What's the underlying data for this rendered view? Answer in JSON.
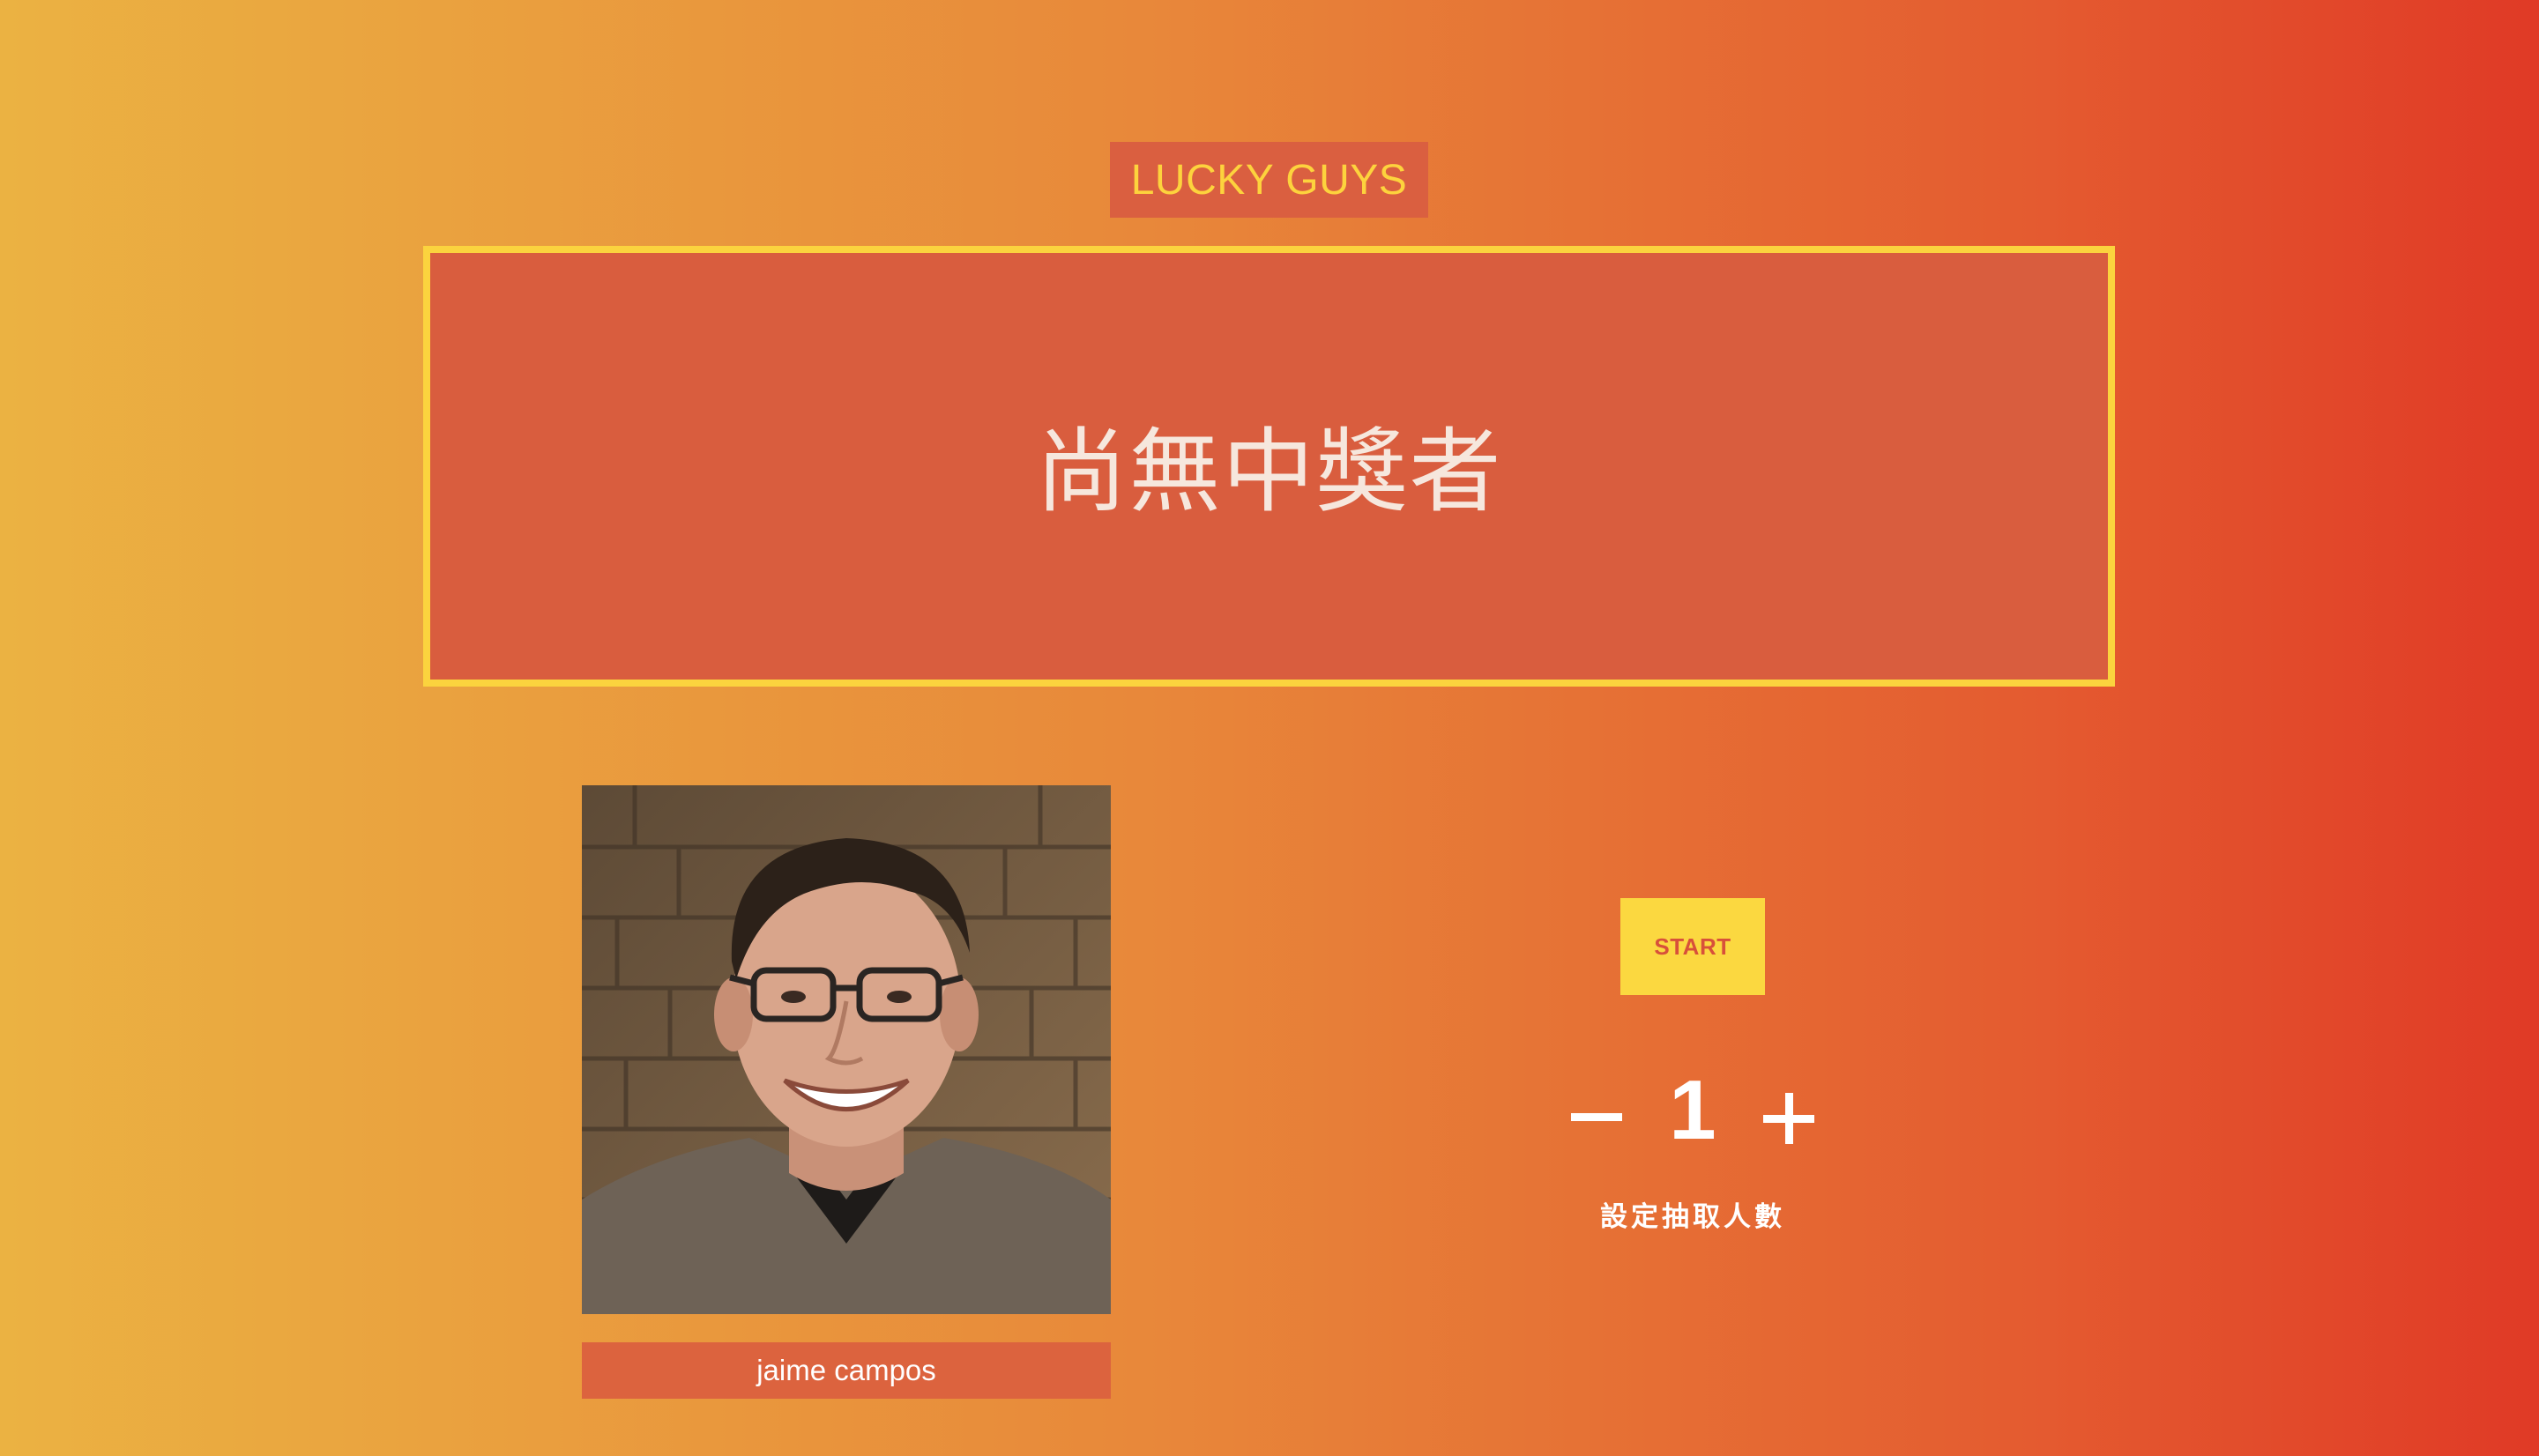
{
  "header": {
    "title": "LUCKY GUYS"
  },
  "winner": {
    "placeholder_text": "尚無中獎者"
  },
  "participant": {
    "name": "jaime campos",
    "photo_icon": "person-photo"
  },
  "controls": {
    "start_label": "START",
    "minus_icon": "minus-icon",
    "plus_icon": "plus-icon",
    "draw_count": "1",
    "draw_count_label": "設定抽取人數"
  },
  "colors": {
    "gradient_start": "#ebb242",
    "gradient_end": "#e03a26",
    "accent_yellow": "#fbd33e",
    "panel_red": "#d95d3e"
  }
}
